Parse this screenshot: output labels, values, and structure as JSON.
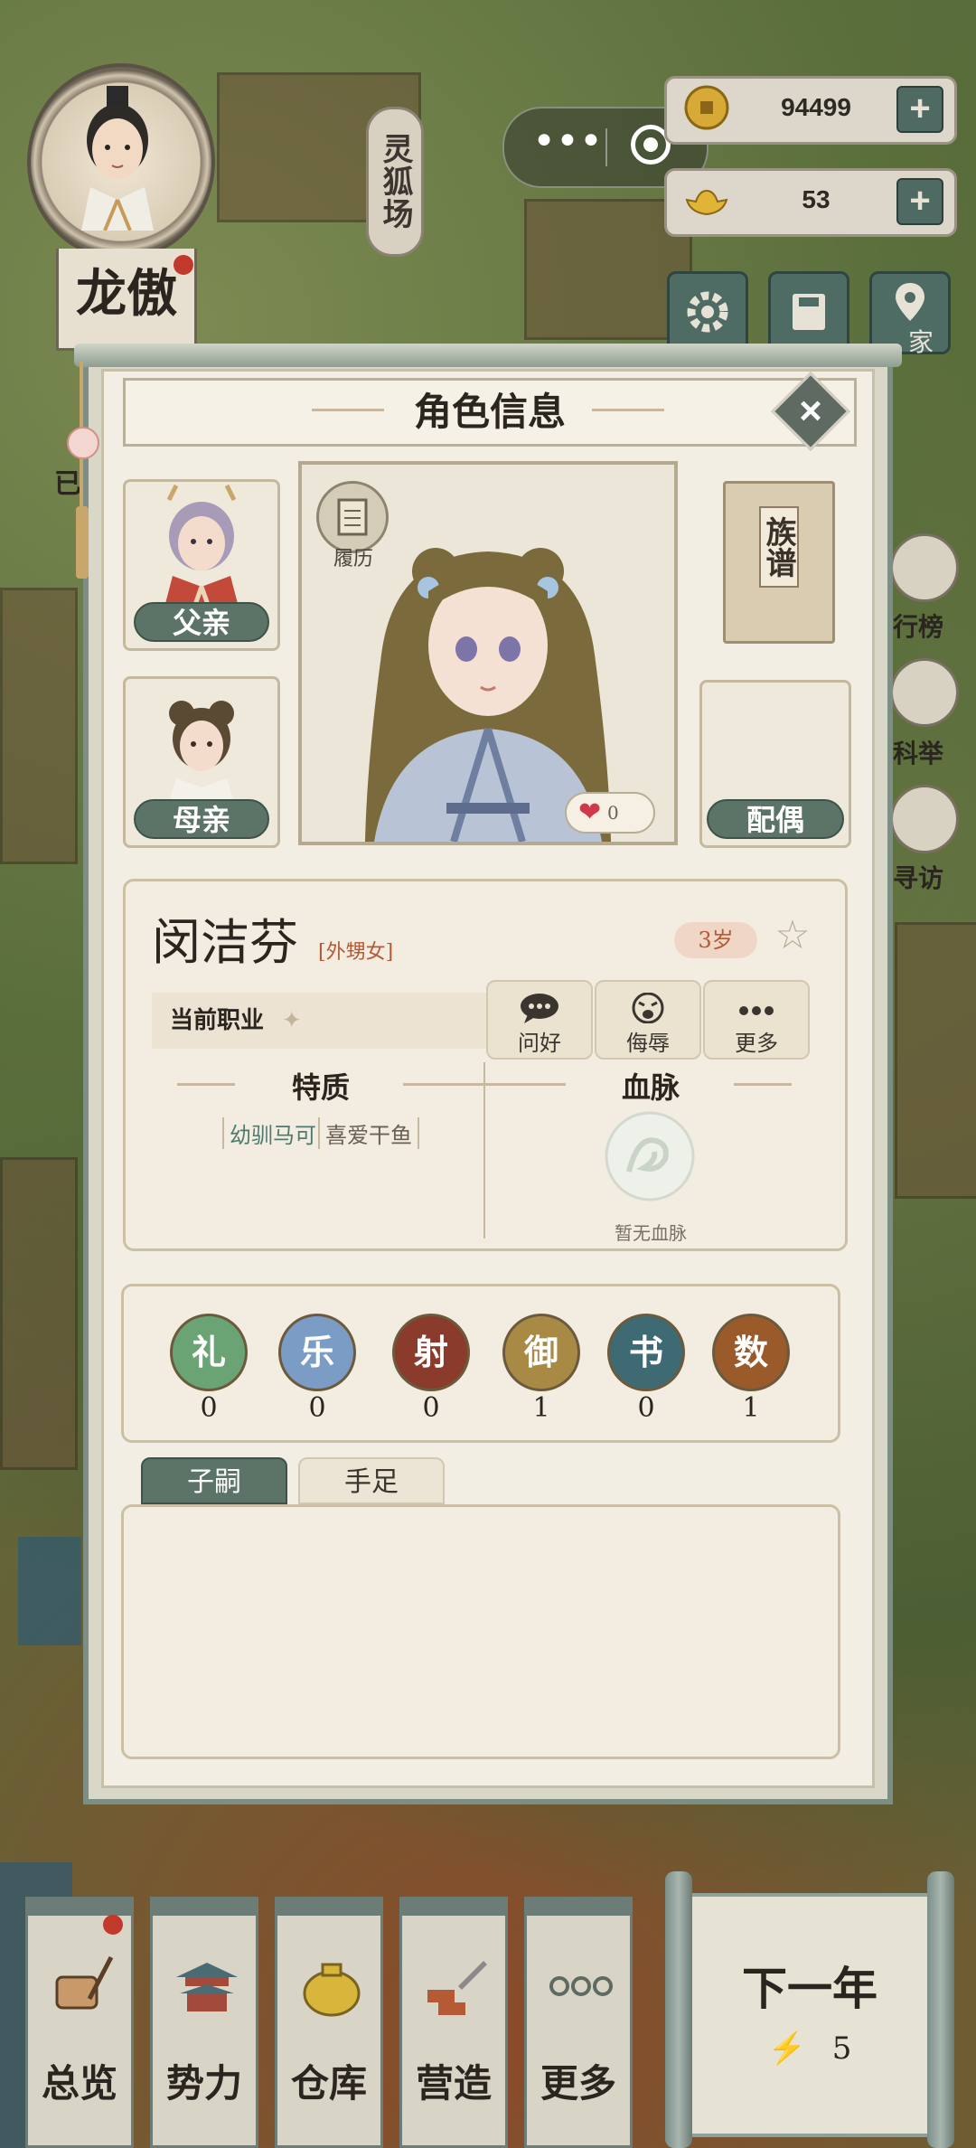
{
  "hud": {
    "player_name": "龙傲",
    "player_name_partial": "已",
    "location_tag": "灵狐场",
    "coins": "94499",
    "ingots": "53",
    "side_labels": [
      "家",
      "行榜",
      "科举",
      "寻访"
    ]
  },
  "dialog": {
    "title": "角色信息",
    "father_label": "父亲",
    "mother_label": "母亲",
    "spouse_label": "配偶",
    "resume_label": "履历",
    "genealogy_label": "族谱",
    "likes": "0"
  },
  "character": {
    "name": "闵洁芬",
    "relation": "[外甥女]",
    "age": "3岁",
    "job_label": "当前职业",
    "actions": [
      {
        "label": "问好",
        "icon": "chat-icon"
      },
      {
        "label": "侮辱",
        "icon": "angry-face-icon"
      },
      {
        "label": "更多",
        "icon": "more-dots-icon"
      }
    ],
    "traits_title": "特质",
    "traits": [
      "幼驯马可",
      "喜爱干鱼"
    ],
    "bloodline_title": "血脉",
    "bloodline_empty": "暂无血脉"
  },
  "skills": [
    {
      "name": "礼",
      "value": "0",
      "color": "#6aa374"
    },
    {
      "name": "乐",
      "value": "0",
      "color": "#7b9cc4"
    },
    {
      "name": "射",
      "value": "0",
      "color": "#8a3b2b"
    },
    {
      "name": "御",
      "value": "1",
      "color": "#a98a45"
    },
    {
      "name": "书",
      "value": "0",
      "color": "#3e6a74"
    },
    {
      "name": "数",
      "value": "1",
      "color": "#9a5a2a"
    }
  ],
  "tabs": [
    {
      "label": "子嗣",
      "active": true
    },
    {
      "label": "手足",
      "active": false
    }
  ],
  "bottom_menu": [
    {
      "label": "总览",
      "icon": "scroll-brush-icon"
    },
    {
      "label": "势力",
      "icon": "palace-icon"
    },
    {
      "label": "仓库",
      "icon": "sack-icon"
    },
    {
      "label": "营造",
      "icon": "trowel-bricks-icon"
    },
    {
      "label": "更多",
      "icon": "more-dots-icon"
    }
  ],
  "next_year": {
    "label": "下一年",
    "energy": "5"
  },
  "colors": {
    "accent_green": "#5c7468",
    "panel_bg": "#f3eee3",
    "relation_red": "#b55a34"
  }
}
